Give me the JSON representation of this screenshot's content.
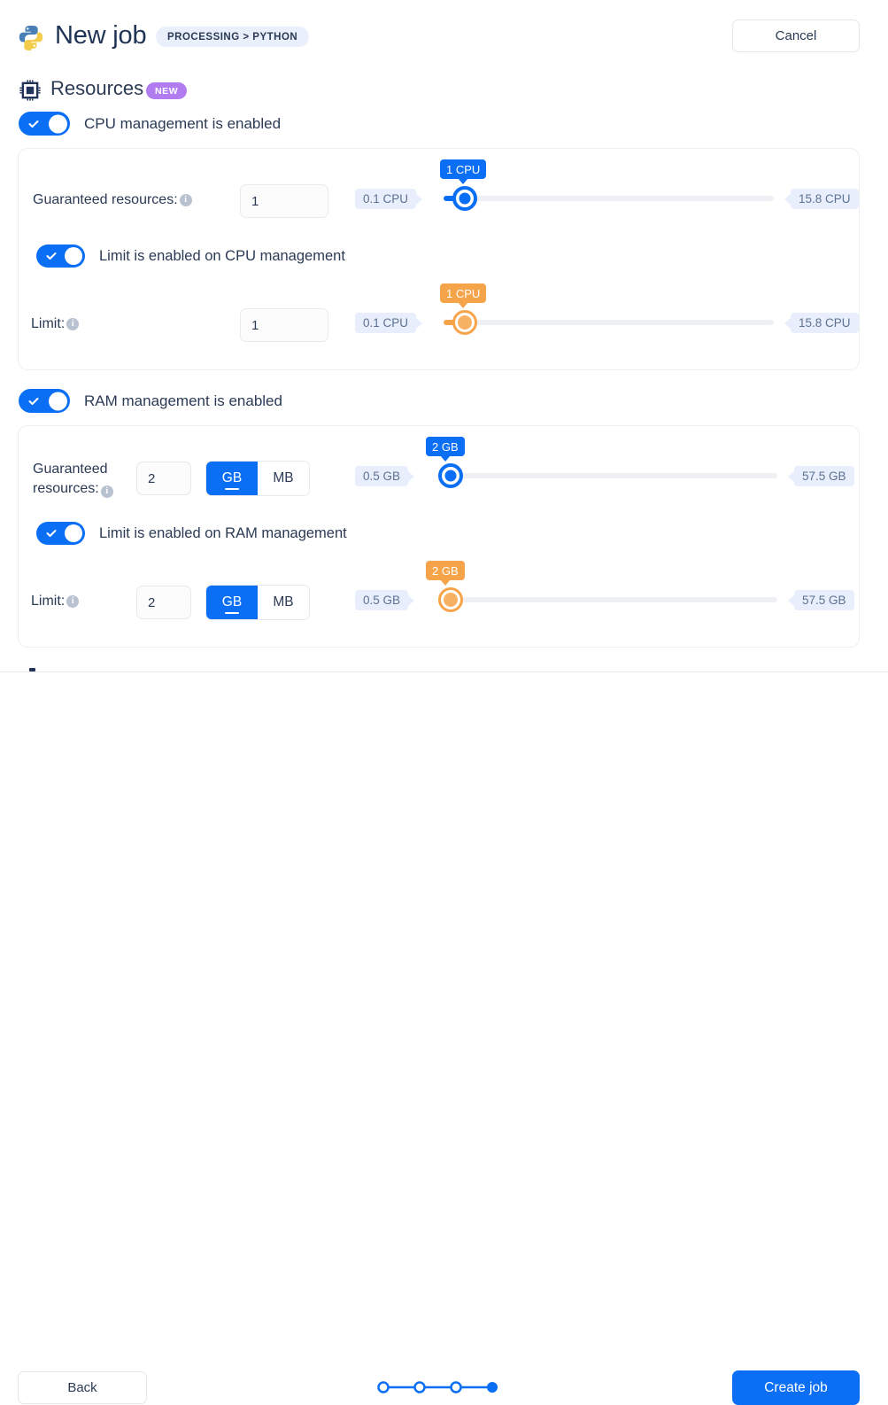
{
  "header": {
    "logo_icon": "python-logo-icon",
    "title": "New job",
    "chip": "PROCESSING > PYTHON",
    "cancel_label": "Cancel"
  },
  "section": {
    "icon": "cpu-chip-icon",
    "title": "Resources",
    "badge": "NEW"
  },
  "cpu": {
    "toggle_label": "CPU management is enabled",
    "toggle_on": "true",
    "guaranteed": {
      "label": "Guaranteed resources:",
      "info_glyph": "i",
      "value": "1",
      "min_label": "0.1 CPU",
      "max_label": "15.8 CPU",
      "bubble": "1 CPU",
      "accent": "#0b6ff5"
    },
    "limit_toggle_label": "Limit is enabled on CPU management",
    "limit": {
      "label": "Limit:",
      "info_glyph": "i",
      "value": "1",
      "min_label": "0.1 CPU",
      "max_label": "15.8 CPU",
      "bubble": "1 CPU",
      "accent": "#f5a44a"
    }
  },
  "ram": {
    "toggle_label": "RAM management is enabled",
    "toggle_on": "true",
    "guaranteed": {
      "label": "Guaranteed resources:",
      "info_glyph": "i",
      "value": "2",
      "unit_gb": "GB",
      "unit_mb": "MB",
      "unit_selected": "GB",
      "min_label": "0.5 GB",
      "max_label": "57.5 GB",
      "bubble": "2 GB",
      "accent": "#0b6ff5"
    },
    "limit_toggle_label": "Limit is enabled on RAM management",
    "limit": {
      "label": "Limit:",
      "info_glyph": "i",
      "value": "2",
      "unit_gb": "GB",
      "unit_mb": "MB",
      "unit_selected": "GB",
      "min_label": "0.5 GB",
      "max_label": "57.5 GB",
      "bubble": "2 GB",
      "accent": "#f5a44a"
    }
  },
  "footer": {
    "back_label": "Back",
    "create_label": "Create job",
    "steps_total": "4",
    "steps_current": "4"
  }
}
